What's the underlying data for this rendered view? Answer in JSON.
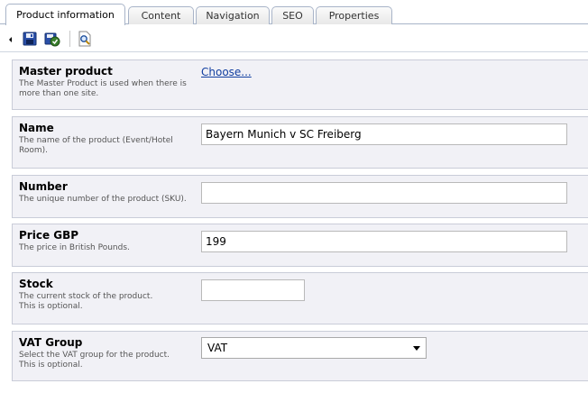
{
  "tabs": [
    {
      "label": "Product information"
    },
    {
      "label": "Content"
    },
    {
      "label": "Navigation"
    },
    {
      "label": "SEO"
    },
    {
      "label": "Properties"
    }
  ],
  "toolbar": {
    "icons": [
      "save-icon",
      "save-and-close-icon",
      "preview-icon"
    ]
  },
  "fields": {
    "master_product": {
      "title": "Master product",
      "desc": "The Master Product is used when there is more than one site.",
      "link": "Choose..."
    },
    "name": {
      "title": "Name",
      "desc": "The name of the product (Event/Hotel Room).",
      "value": "Bayern Munich v SC Freiberg"
    },
    "number": {
      "title": "Number",
      "desc": "The unique number of the product (SKU).",
      "value": ""
    },
    "price": {
      "title": "Price GBP",
      "desc": "The price in British Pounds.",
      "value": "199"
    },
    "stock": {
      "title": "Stock",
      "desc_1": "The current stock of the product.",
      "desc_2": "This is optional.",
      "value": ""
    },
    "vat_group": {
      "title": "VAT Group",
      "desc_1": "Select the VAT group for the product.",
      "desc_2": "This is optional.",
      "value": "VAT"
    }
  }
}
